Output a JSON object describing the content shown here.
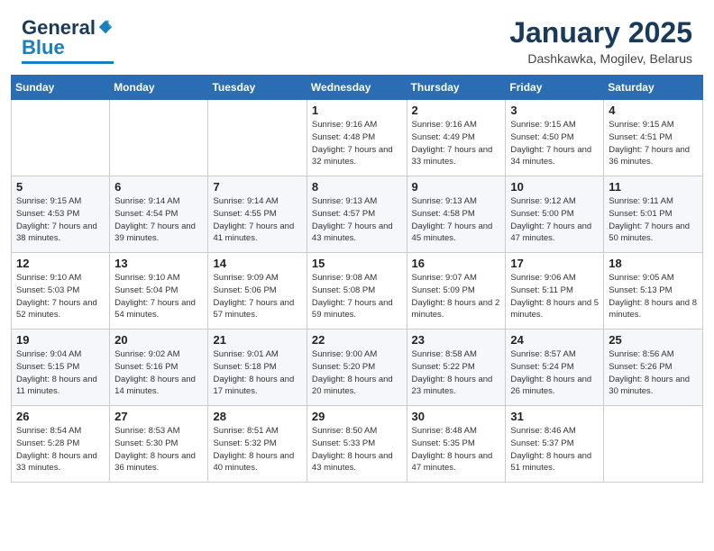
{
  "header": {
    "logo_general": "General",
    "logo_blue": "Blue",
    "month_title": "January 2025",
    "location": "Dashkawka, Mogilev, Belarus"
  },
  "weekdays": [
    "Sunday",
    "Monday",
    "Tuesday",
    "Wednesday",
    "Thursday",
    "Friday",
    "Saturday"
  ],
  "weeks": [
    [
      {
        "day": "",
        "info": ""
      },
      {
        "day": "",
        "info": ""
      },
      {
        "day": "",
        "info": ""
      },
      {
        "day": "1",
        "info": "Sunrise: 9:16 AM\nSunset: 4:48 PM\nDaylight: 7 hours and 32 minutes."
      },
      {
        "day": "2",
        "info": "Sunrise: 9:16 AM\nSunset: 4:49 PM\nDaylight: 7 hours and 33 minutes."
      },
      {
        "day": "3",
        "info": "Sunrise: 9:15 AM\nSunset: 4:50 PM\nDaylight: 7 hours and 34 minutes."
      },
      {
        "day": "4",
        "info": "Sunrise: 9:15 AM\nSunset: 4:51 PM\nDaylight: 7 hours and 36 minutes."
      }
    ],
    [
      {
        "day": "5",
        "info": "Sunrise: 9:15 AM\nSunset: 4:53 PM\nDaylight: 7 hours and 38 minutes."
      },
      {
        "day": "6",
        "info": "Sunrise: 9:14 AM\nSunset: 4:54 PM\nDaylight: 7 hours and 39 minutes."
      },
      {
        "day": "7",
        "info": "Sunrise: 9:14 AM\nSunset: 4:55 PM\nDaylight: 7 hours and 41 minutes."
      },
      {
        "day": "8",
        "info": "Sunrise: 9:13 AM\nSunset: 4:57 PM\nDaylight: 7 hours and 43 minutes."
      },
      {
        "day": "9",
        "info": "Sunrise: 9:13 AM\nSunset: 4:58 PM\nDaylight: 7 hours and 45 minutes."
      },
      {
        "day": "10",
        "info": "Sunrise: 9:12 AM\nSunset: 5:00 PM\nDaylight: 7 hours and 47 minutes."
      },
      {
        "day": "11",
        "info": "Sunrise: 9:11 AM\nSunset: 5:01 PM\nDaylight: 7 hours and 50 minutes."
      }
    ],
    [
      {
        "day": "12",
        "info": "Sunrise: 9:10 AM\nSunset: 5:03 PM\nDaylight: 7 hours and 52 minutes."
      },
      {
        "day": "13",
        "info": "Sunrise: 9:10 AM\nSunset: 5:04 PM\nDaylight: 7 hours and 54 minutes."
      },
      {
        "day": "14",
        "info": "Sunrise: 9:09 AM\nSunset: 5:06 PM\nDaylight: 7 hours and 57 minutes."
      },
      {
        "day": "15",
        "info": "Sunrise: 9:08 AM\nSunset: 5:08 PM\nDaylight: 7 hours and 59 minutes."
      },
      {
        "day": "16",
        "info": "Sunrise: 9:07 AM\nSunset: 5:09 PM\nDaylight: 8 hours and 2 minutes."
      },
      {
        "day": "17",
        "info": "Sunrise: 9:06 AM\nSunset: 5:11 PM\nDaylight: 8 hours and 5 minutes."
      },
      {
        "day": "18",
        "info": "Sunrise: 9:05 AM\nSunset: 5:13 PM\nDaylight: 8 hours and 8 minutes."
      }
    ],
    [
      {
        "day": "19",
        "info": "Sunrise: 9:04 AM\nSunset: 5:15 PM\nDaylight: 8 hours and 11 minutes."
      },
      {
        "day": "20",
        "info": "Sunrise: 9:02 AM\nSunset: 5:16 PM\nDaylight: 8 hours and 14 minutes."
      },
      {
        "day": "21",
        "info": "Sunrise: 9:01 AM\nSunset: 5:18 PM\nDaylight: 8 hours and 17 minutes."
      },
      {
        "day": "22",
        "info": "Sunrise: 9:00 AM\nSunset: 5:20 PM\nDaylight: 8 hours and 20 minutes."
      },
      {
        "day": "23",
        "info": "Sunrise: 8:58 AM\nSunset: 5:22 PM\nDaylight: 8 hours and 23 minutes."
      },
      {
        "day": "24",
        "info": "Sunrise: 8:57 AM\nSunset: 5:24 PM\nDaylight: 8 hours and 26 minutes."
      },
      {
        "day": "25",
        "info": "Sunrise: 8:56 AM\nSunset: 5:26 PM\nDaylight: 8 hours and 30 minutes."
      }
    ],
    [
      {
        "day": "26",
        "info": "Sunrise: 8:54 AM\nSunset: 5:28 PM\nDaylight: 8 hours and 33 minutes."
      },
      {
        "day": "27",
        "info": "Sunrise: 8:53 AM\nSunset: 5:30 PM\nDaylight: 8 hours and 36 minutes."
      },
      {
        "day": "28",
        "info": "Sunrise: 8:51 AM\nSunset: 5:32 PM\nDaylight: 8 hours and 40 minutes."
      },
      {
        "day": "29",
        "info": "Sunrise: 8:50 AM\nSunset: 5:33 PM\nDaylight: 8 hours and 43 minutes."
      },
      {
        "day": "30",
        "info": "Sunrise: 8:48 AM\nSunset: 5:35 PM\nDaylight: 8 hours and 47 minutes."
      },
      {
        "day": "31",
        "info": "Sunrise: 8:46 AM\nSunset: 5:37 PM\nDaylight: 8 hours and 51 minutes."
      },
      {
        "day": "",
        "info": ""
      }
    ]
  ]
}
